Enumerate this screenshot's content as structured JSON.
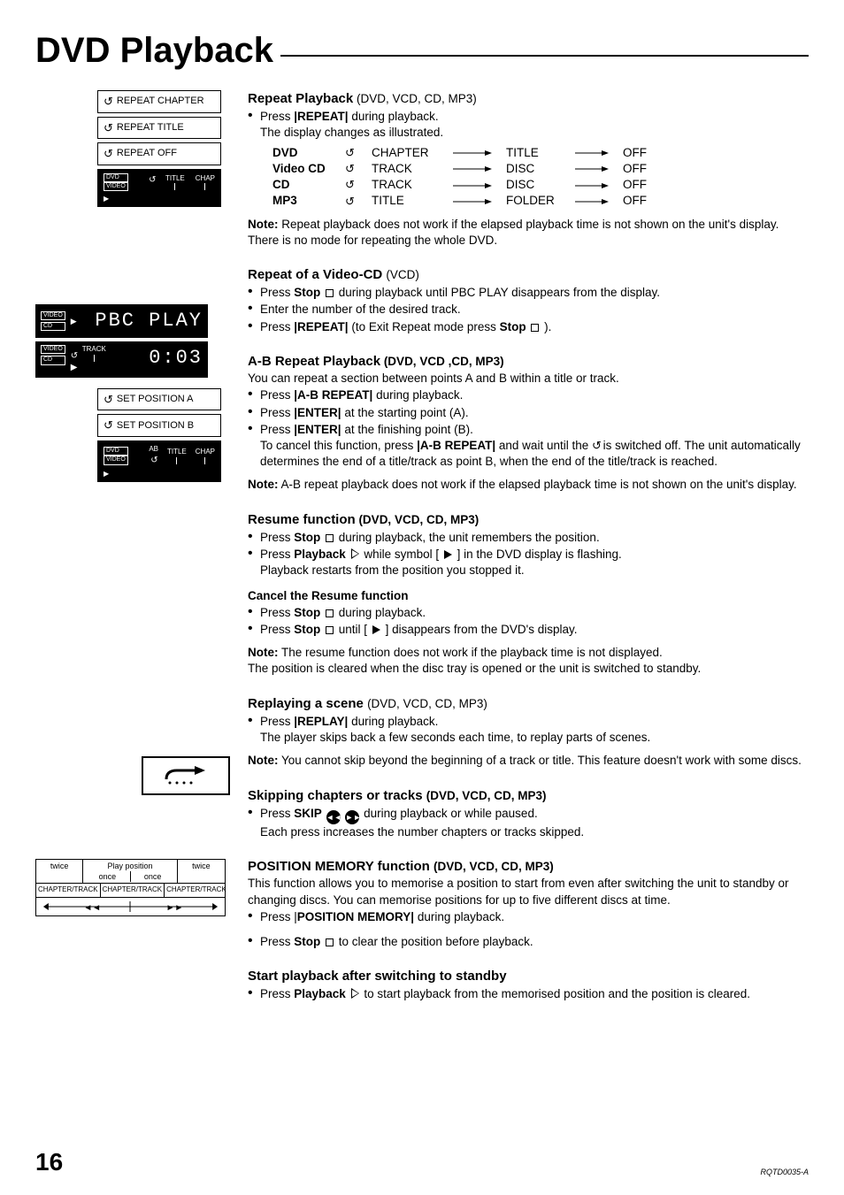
{
  "pageTitle": "DVD Playback",
  "pageNumber": "16",
  "footerCode": "RQTD0035-A",
  "leftCol": {
    "repeatBoxes": [
      "REPEAT CHAPTER",
      "REPEAT TITLE",
      "REPEAT OFF"
    ],
    "repeatDark": {
      "dvdVideo": "DVD\nVIDEO",
      "title": "TITLE",
      "chap": "CHAP"
    },
    "pbcDisp1": {
      "tags": [
        "VIDEO",
        "CD"
      ],
      "text": "PBC  PLAY"
    },
    "pbcDisp2": {
      "tags": [
        "VIDEO",
        "CD"
      ],
      "track": "TRACK",
      "text": "0:03"
    },
    "posBoxes": [
      "SET POSITION A",
      "SET POSITION B"
    ],
    "posDark": {
      "dvdVideo": "DVD\nVIDEO",
      "ab": "AB",
      "title": "TITLE",
      "chap": "CHAP"
    },
    "replayIcon": "↪",
    "navTable": {
      "topCenter": "Play position",
      "twice": "twice",
      "once": "once",
      "chapTrack": "CHAPTER/TRACK"
    }
  },
  "sections": {
    "repeat": {
      "title": "Repeat Playback",
      "titleSub": "(DVD, VCD, CD, MP3)",
      "b1a": "Press ",
      "b1b": "|REPEAT|",
      "b1c": " during playback.",
      "b1d": "The display changes as illustrated.",
      "rows": [
        {
          "media": "DVD",
          "c1": "CHAPTER",
          "c2": "TITLE",
          "c3": "OFF"
        },
        {
          "media": "Video CD",
          "c1": "TRACK",
          "c2": "DISC",
          "c3": "OFF"
        },
        {
          "media": "CD",
          "c1": "TRACK",
          "c2": "DISC",
          "c3": "OFF"
        },
        {
          "media": "MP3",
          "c1": "TITLE",
          "c2": "FOLDER",
          "c3": "OFF"
        }
      ],
      "noteLabel": "Note:",
      "note": " Repeat playback does not work if the elapsed playback time is not shown on the unit's display. There is no mode for repeating the whole DVD."
    },
    "repeatVcd": {
      "title": "Repeat of a Video-CD ",
      "titleSub": "(VCD)",
      "b1a": "Press ",
      "b1b": "Stop",
      "b1c": " during playback until  PBC PLAY disappears from the display.",
      "b2": "Enter the number of the desired track.",
      "b3a": "Press ",
      "b3b": "|REPEAT|",
      "b3c": " (to Exit Repeat mode press ",
      "b3d": "Stop",
      "b3e": " )."
    },
    "ab": {
      "title": "A-B Repeat Playback",
      "titleSub": "   (DVD, VCD ,CD, MP3)",
      "intro": "You can repeat a section between points A and B within a title or track.",
      "b1a": "Press ",
      "b1b": "|A-B REPEAT|",
      "b1c": " during playback.",
      "b2a": "Press ",
      "b2b": "|ENTER|",
      "b2c": " at the starting point (A).",
      "b3a": "Press ",
      "b3b": "|ENTER|",
      "b3c": " at the finishing point (B).",
      "b3d": "To cancel this function, press ",
      "b3e": "|A-B REPEAT|",
      "b3f": " and wait until the ",
      "b3g": " is switched off. The unit automatically determines the end of a title/track as point B, when the end of  the title/track is reached.",
      "noteLabel": "Note:",
      "note": " A-B repeat playback does not work if the elapsed playback time is not shown on the unit's display."
    },
    "resume": {
      "title": "Resume function",
      "titleSub": "  (DVD, VCD, CD, MP3)",
      "b1a": "Press ",
      "b1b": "Stop",
      "b1c": " during playback, the unit remembers the position.",
      "b2a": "Press ",
      "b2b": "Playback",
      "b2c": " while  symbol [",
      "b2d": " ] in the DVD display is flashing.",
      "b2e": "Playback restarts from the position you stopped it.",
      "cancelTitle": "Cancel the Resume function",
      "c1a": "Press ",
      "c1b": "Stop",
      "c1c": " during playback.",
      "c2a": "Press ",
      "c2b": "Stop",
      "c2c": " until [",
      "c2d": " ] disappears from the DVD's display.",
      "noteLabel": "Note:",
      "note": "  The resume function does not work if the playback time is not displayed.",
      "note2": "The position is cleared when the disc tray is opened or the unit is switched to standby."
    },
    "replay": {
      "title": "Replaying a scene ",
      "titleSub": "(DVD, VCD, CD, MP3)",
      "b1a": "Press ",
      "b1b": "|REPLAY|",
      "b1c": " during playback.",
      "b1d": "The player skips back a few seconds each time, to replay parts of scenes.",
      "noteLabel": "Note:",
      "note": " You cannot skip beyond the beginning of a track or title. This feature doesn't work with some discs."
    },
    "skip": {
      "title": "Skipping chapters or tracks ",
      "titleSub": "(DVD, VCD, CD, MP3)",
      "b1a": "Press ",
      "b1b": "SKIP",
      "b1c": " during playback or while paused.",
      "b1d": "Each press increases the number chapters or tracks skipped."
    },
    "posmem": {
      "title": "POSITION MEMORY function ",
      "titleSub": "(DVD, VCD, CD, MP3)",
      "intro": "This function allows you to memorise a position to start from even after switching the unit to standby or changing discs. You can memorise positions for up to five different discs at time.",
      "b1a": "Press |",
      "b1b": "POSITION MEMORY|",
      "b1c": " during playback.",
      "b2a": "Press ",
      "b2b": "Stop",
      "b2c": " to clear the position before playback."
    },
    "standby": {
      "title": "Start playback after switching to standby",
      "b1a": "Press ",
      "b1b": "Playback",
      "b1c": " to start playback from the memorised position and the position is cleared."
    }
  }
}
